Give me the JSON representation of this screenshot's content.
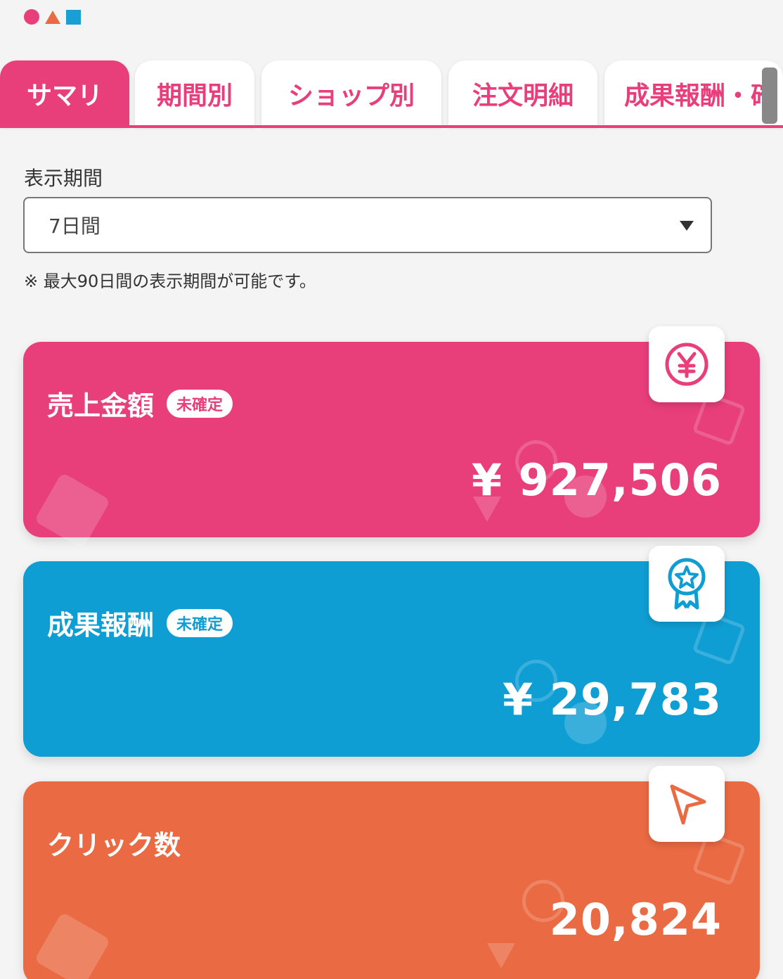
{
  "brand": {
    "shapes": [
      "pink-circle",
      "orange-triangle",
      "blue-square"
    ],
    "colors": {
      "pink": "#e83e79",
      "orange": "#ea6a43",
      "blue": "#1a9fd4"
    }
  },
  "tabs": [
    {
      "label": "サマリ",
      "active": true
    },
    {
      "label": "期間別",
      "active": false
    },
    {
      "label": "ショップ別",
      "active": false
    },
    {
      "label": "注文明細",
      "active": false
    },
    {
      "label": "成果報酬・確",
      "active": false
    }
  ],
  "period": {
    "label": "表示期間",
    "selected": "7日間",
    "note": "※ 最大90日間の表示期間が可能です。"
  },
  "cards": {
    "sales": {
      "title": "売上金額",
      "badge": "未確定",
      "value": "¥ 927,506",
      "icon": "yen-icon",
      "color": "#e83e79"
    },
    "reward": {
      "title": "成果報酬",
      "badge": "未確定",
      "value": "¥ 29,783",
      "icon": "award-ribbon-icon",
      "color": "#0f9ed4"
    },
    "clicks": {
      "title": "クリック数",
      "value": "20,824",
      "icon": "cursor-arrow-icon",
      "color": "#ea6a43"
    }
  }
}
